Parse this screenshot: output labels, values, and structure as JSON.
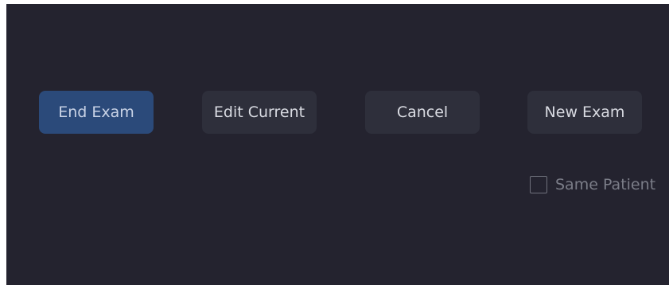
{
  "dialog": {
    "buttons": {
      "end_exam": "End Exam",
      "edit_current": "Edit Current",
      "cancel": "Cancel",
      "new_exam": "New Exam"
    },
    "same_patient": {
      "label": "Same Patient",
      "checked": false
    }
  },
  "colors": {
    "background": "#24232f",
    "primary_button": "#2b4a7a",
    "secondary_button": "#2e2f3b",
    "button_text": "#d9dbe2",
    "muted_text": "#7b7d88"
  }
}
